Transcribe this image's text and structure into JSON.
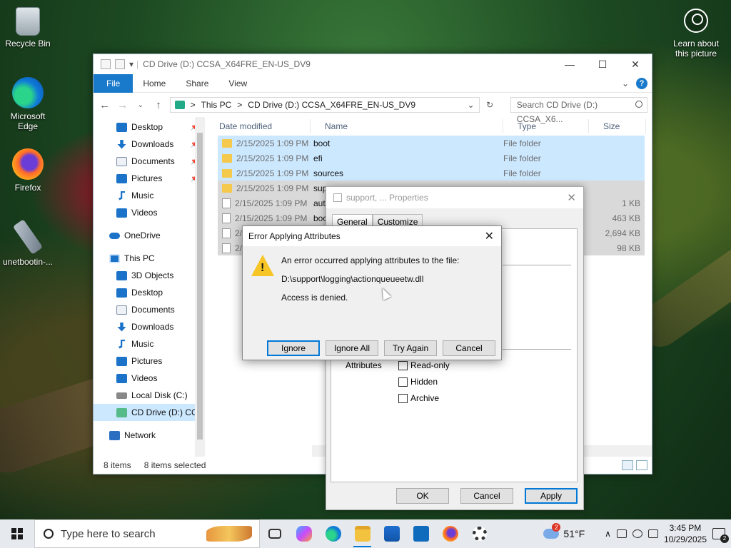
{
  "desktop": {
    "icons": [
      {
        "label": "Recycle Bin",
        "icon": "recycle-bin-icon"
      },
      {
        "label": "Microsoft Edge",
        "icon": "edge-icon"
      },
      {
        "label": "Firefox",
        "icon": "firefox-icon"
      },
      {
        "label": "unetbootin-...",
        "icon": "unetbootin-icon"
      }
    ],
    "learn": "Learn about this picture"
  },
  "explorer": {
    "title": "CD Drive (D:) CCSA_X64FRE_EN-US_DV9",
    "ribbon": {
      "file": "File",
      "home": "Home",
      "share": "Share",
      "view": "View"
    },
    "address": {
      "part1": "This PC",
      "sep": ">",
      "part2": "CD Drive (D:) CCSA_X64FRE_EN-US_DV9"
    },
    "search_placeholder": "Search CD Drive (D:) CCSA_X6...",
    "nav": {
      "quick": [
        {
          "label": "Desktop",
          "icon": "desktop-icon",
          "pinned": true
        },
        {
          "label": "Downloads",
          "icon": "downloads-icon",
          "pinned": true
        },
        {
          "label": "Documents",
          "icon": "documents-icon",
          "pinned": true
        },
        {
          "label": "Pictures",
          "icon": "pictures-icon",
          "pinned": true
        },
        {
          "label": "Music",
          "icon": "music-icon"
        },
        {
          "label": "Videos",
          "icon": "videos-icon"
        }
      ],
      "onedrive": "OneDrive",
      "thispc": "This PC",
      "pc_items": [
        {
          "label": "3D Objects",
          "icon": "3d-objects-icon"
        },
        {
          "label": "Desktop",
          "icon": "desktop-icon"
        },
        {
          "label": "Documents",
          "icon": "documents-icon"
        },
        {
          "label": "Downloads",
          "icon": "downloads-icon"
        },
        {
          "label": "Music",
          "icon": "music-icon"
        },
        {
          "label": "Pictures",
          "icon": "pictures-icon"
        },
        {
          "label": "Videos",
          "icon": "videos-icon"
        },
        {
          "label": "Local Disk (C:)",
          "icon": "disk-icon"
        },
        {
          "label": "CD Drive (D:) CC",
          "icon": "cd-drive-icon",
          "selected": true
        }
      ],
      "network": "Network"
    },
    "columns": {
      "date": "Date modified",
      "name": "Name",
      "type": "Type",
      "size": "Size"
    },
    "files": [
      {
        "date": "2/15/2025 1:09 PM",
        "name": "boot",
        "type": "File folder",
        "size": "",
        "kind": "folder"
      },
      {
        "date": "2/15/2025 1:09 PM",
        "name": "efi",
        "type": "File folder",
        "size": "",
        "kind": "folder"
      },
      {
        "date": "2/15/2025 1:09 PM",
        "name": "sources",
        "type": "File folder",
        "size": "",
        "kind": "folder"
      },
      {
        "date": "2/15/2025 1:09 PM",
        "name": "sup",
        "type": "",
        "size": "",
        "kind": "folder"
      },
      {
        "date": "2/15/2025 1:09 PM",
        "name": "aut",
        "type": "",
        "size": "1 KB",
        "kind": "file"
      },
      {
        "date": "2/15/2025 1:09 PM",
        "name": "boo",
        "type": "",
        "size": "463 KB",
        "kind": "file"
      },
      {
        "date": "2/15",
        "name": "",
        "type": "",
        "size": "2,694 KB",
        "kind": "file"
      },
      {
        "date": "2/15",
        "name": "",
        "type": "",
        "size": "98 KB",
        "kind": "file"
      }
    ],
    "status": {
      "count": "8 items",
      "selected": "8 items selected"
    }
  },
  "properties": {
    "title": "support, ... Properties",
    "tabs": [
      "General",
      "Customize"
    ],
    "attributes_label": "Attributes",
    "checks": [
      "Read-only",
      "Hidden",
      "Archive"
    ],
    "ok": "OK",
    "cancel": "Cancel",
    "apply": "Apply"
  },
  "error": {
    "title": "Error Applying Attributes",
    "line1": "An error occurred applying attributes to the file:",
    "line2": "D:\\support\\logging\\actionqueueetw.dll",
    "line3": "Access is denied.",
    "ignore": "Ignore",
    "ignore_all": "Ignore All",
    "try_again": "Try Again",
    "cancel": "Cancel"
  },
  "taskbar": {
    "search": "Type here to search",
    "weather": "51°F",
    "weather_badge": "2",
    "time": "3:45 PM",
    "date": "10/29/2025",
    "notifications": "2"
  }
}
